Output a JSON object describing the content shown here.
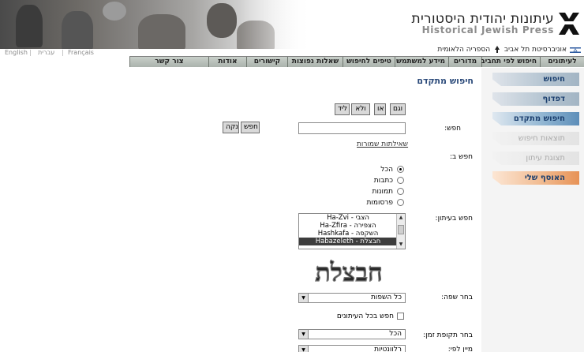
{
  "header": {
    "title_hebrew": "עיתונות יהודית היסטורית",
    "title_english": "Historical Jewish Press",
    "affiliation_library": "הספריה הלאומית",
    "affiliation_university": "אוניברסיטת תל אביב"
  },
  "languages": {
    "english": "English",
    "hebrew": "עברית",
    "french": "Français"
  },
  "topnav": [
    "לעיתונים",
    "חיפוש לפי תחביב",
    "מדורים",
    "מידע למשתמש",
    "טיפים לחיפוש",
    "שאלות נפוצות",
    "קישורים",
    "אודות",
    "צור קשר"
  ],
  "sidebar": {
    "items": [
      {
        "label": "חיפוש",
        "state": "active"
      },
      {
        "label": "דפדוף",
        "state": "active"
      },
      {
        "label": "חיפוש מתקדם",
        "state": "current"
      },
      {
        "label": "תוצאות חיפוש",
        "state": "disabled"
      },
      {
        "label": "תצוגת עיתון",
        "state": "disabled"
      },
      {
        "label": "האוסף שלי",
        "state": "orange"
      }
    ]
  },
  "main": {
    "page_title": "חיפוש מתקדם",
    "operators": {
      "and": "וגם",
      "or": "או",
      "not": "ולא",
      "near": "ליד"
    },
    "search_label": "חפש:",
    "search_value": "",
    "search_button": "חפש",
    "clear_button": "נקה",
    "common_questions": "שאילתות שמורות",
    "search_in_label": "חפש ב:",
    "search_in_options": [
      "הכל",
      "כתבות",
      "תמונות",
      "פרסומות"
    ],
    "newspaper_label": "חפש בעיתון:",
    "newspapers": [
      "Ha-Zvi - הצבי",
      "Ha-Zfira - הצפירה",
      "Hashkafa - השקפה",
      "Habazeleth - חבצלת"
    ],
    "selected_newspaper_index": 3,
    "masthead_text": "חבצלת",
    "language_label": "בחר שפה:",
    "language_value": "כל השפות",
    "all_newspapers_label": "חפש בכל העיתונים",
    "period_label": "בחר תקופת זמן:",
    "period_value": "הכל",
    "sort_label": "מיין לפי:",
    "sort_value": "רלוונטיות"
  },
  "colors": {
    "nav_bar": "#b8c0ba",
    "title_blue": "#2b4a7a",
    "sidebar_current": "#5d8eb9",
    "sidebar_orange": "#e79256"
  }
}
